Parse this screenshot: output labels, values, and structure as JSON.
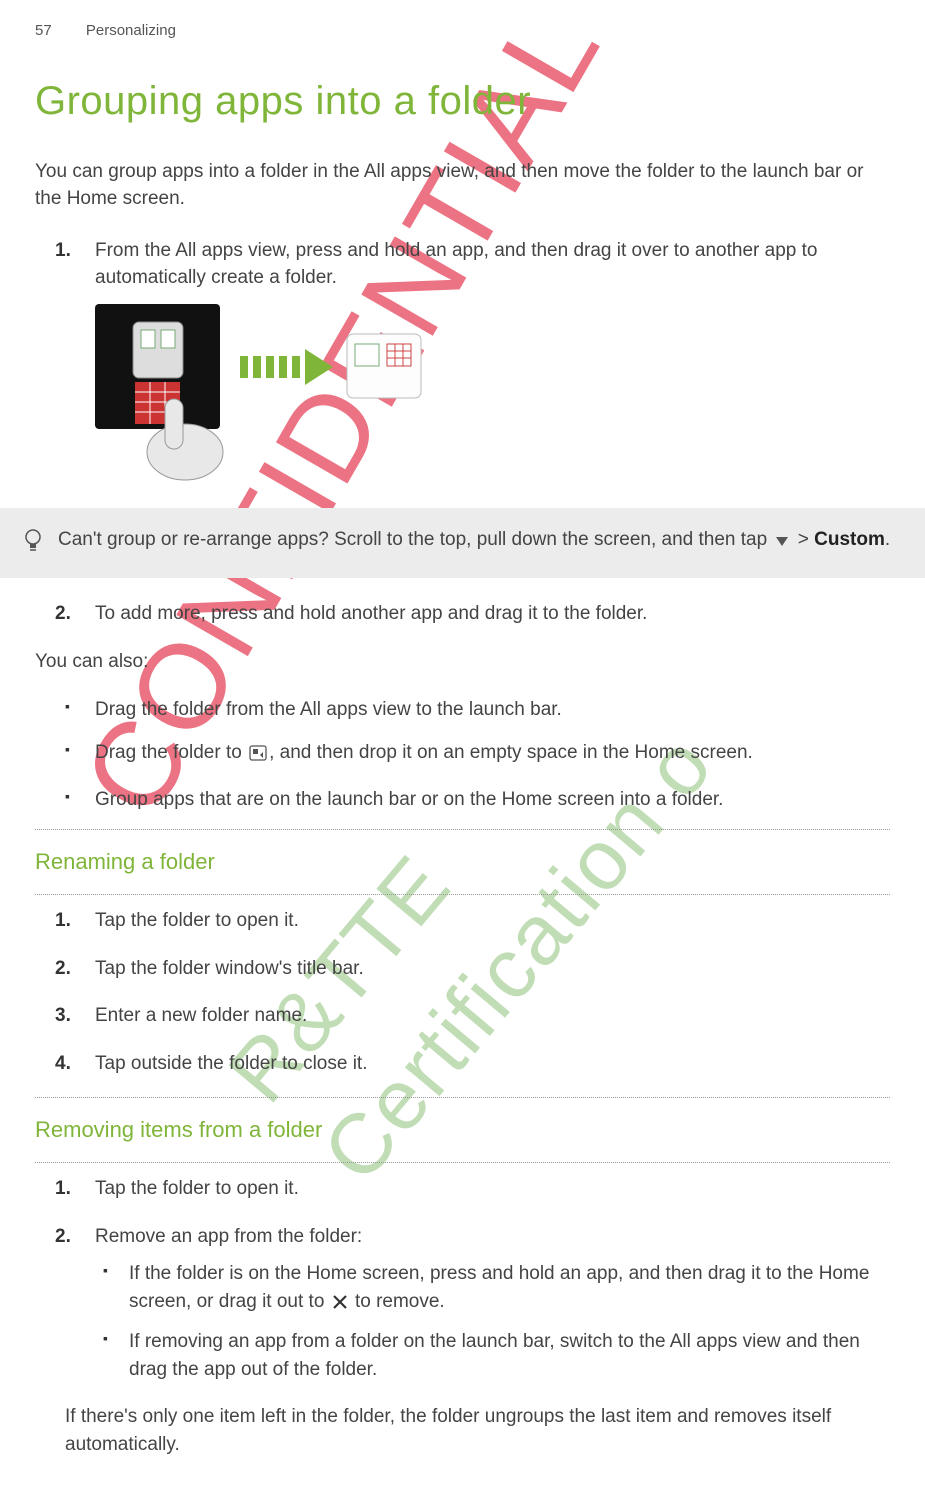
{
  "header": {
    "page_number": "57",
    "section": "Personalizing"
  },
  "title": "Grouping apps into a folder",
  "intro": "You can group apps into a folder in the All apps view, and then move the folder to the launch bar or the Home screen.",
  "steps_main": [
    "From the All apps view, press and hold an app, and then drag it over to another app to automatically create a folder."
  ],
  "tip": {
    "text_before": "Can't group or re-arrange apps? Scroll to the top, pull down the screen, and then tap ",
    "text_after": " > ",
    "custom_label": "Custom",
    "period": "."
  },
  "steps_after": [
    "To add more, press and hold another app and drag it to the folder."
  ],
  "also_intro": "You can also:",
  "also_items": [
    {
      "before": "Drag the folder from the All apps view to the launch bar.",
      "after": ""
    },
    {
      "before": "Drag the folder to ",
      "after": ", and then drop it on an empty space in the Home screen."
    },
    {
      "before": "Group apps that are on the launch bar or on the Home screen into a folder.",
      "after": ""
    }
  ],
  "renaming": {
    "heading": "Renaming a folder",
    "steps": [
      "Tap the folder to open it.",
      "Tap the folder window's title bar.",
      "Enter a new folder name.",
      "Tap outside the folder to close it."
    ]
  },
  "removing": {
    "heading": "Removing items from a folder",
    "steps": [
      {
        "text": "Tap the folder to open it."
      },
      {
        "text": "Remove an app from the folder:",
        "sub": [
          {
            "before": "If the folder is on the Home screen, press and hold an app, and then drag it to the Home screen, or drag it out to ",
            "after": " to remove."
          },
          {
            "before": "If removing an app from a folder on the launch bar, switch to the All apps view and then drag the app out of the folder.",
            "after": ""
          }
        ]
      }
    ]
  },
  "final_note": "If there's only one item left in the folder, the folder ungroups the last item and removes itself automatically."
}
